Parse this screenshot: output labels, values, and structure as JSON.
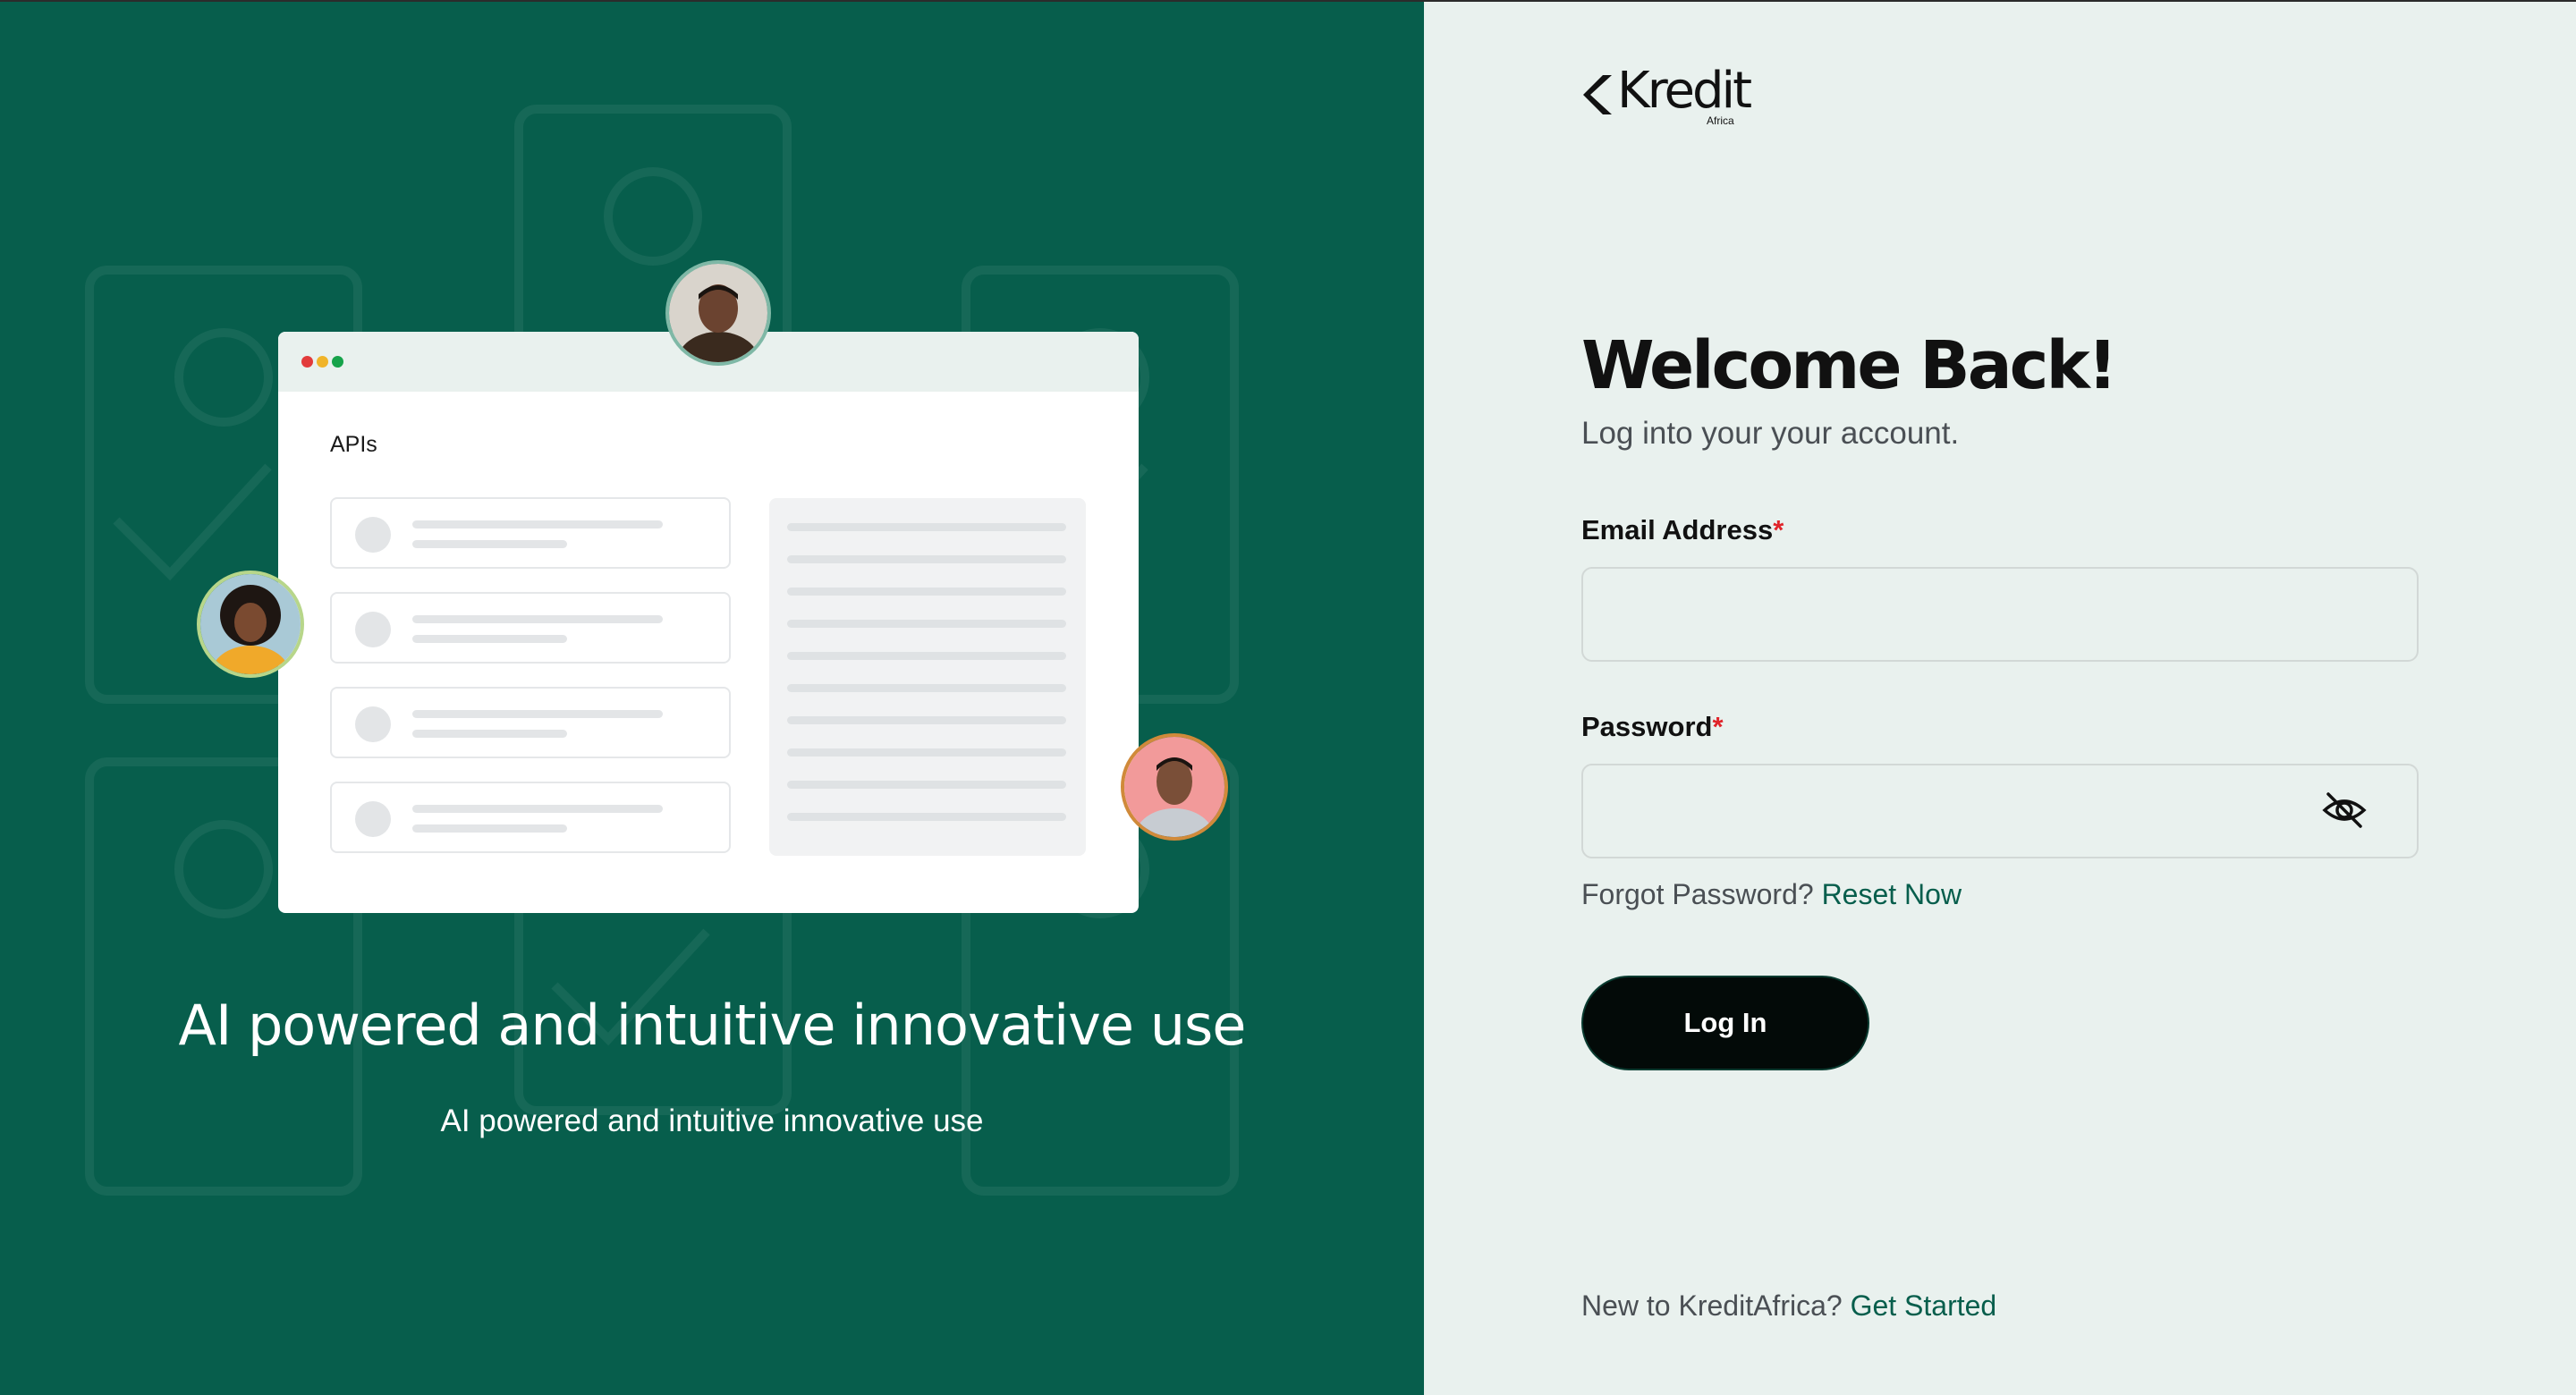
{
  "hero": {
    "mock_title": "APIs",
    "title": "AI powered and intuitive innovative use",
    "subtitle": "AI powered and intuitive innovative use"
  },
  "brand": {
    "name": "Kredit",
    "sub": "Africa"
  },
  "login": {
    "heading": "Welcome Back!",
    "subheading": "Log into your your account.",
    "email_label": "Email Address",
    "email_value": "",
    "password_label": "Password",
    "password_value": "",
    "required_mark": "*",
    "forgot_text": "Forgot Password?",
    "reset_link": "Reset Now",
    "submit_label": "Log In",
    "new_text": "New to KreditAfrica?",
    "get_started_link": "Get Started"
  },
  "colors": {
    "brand_green": "#075e4c",
    "panel_bg": "#e9f1ee",
    "button_bg": "#030a08",
    "required_red": "#e0242a"
  },
  "icons": {
    "password_toggle": "eye-off-icon",
    "logo_mark": "chevron-left-logo-icon"
  }
}
